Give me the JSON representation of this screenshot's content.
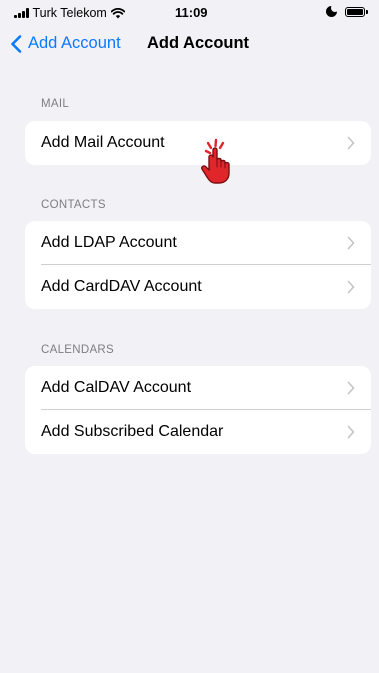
{
  "status_bar": {
    "carrier": "Turk Telekom",
    "time": "11:09",
    "icons": [
      "signal-icon",
      "wifi-icon",
      "moon-icon",
      "battery-icon"
    ]
  },
  "nav": {
    "back_label": "Add Account",
    "title": "Add Account"
  },
  "sections": {
    "mail": {
      "header": "MAIL",
      "rows": [
        "Add Mail Account"
      ]
    },
    "contacts": {
      "header": "CONTACTS",
      "rows": [
        "Add LDAP Account",
        "Add CardDAV Account"
      ]
    },
    "calendars": {
      "header": "CALENDARS",
      "rows": [
        "Add CalDAV Account",
        "Add Subscribed Calendar"
      ]
    }
  },
  "colors": {
    "accent": "#0a7aff",
    "background": "#f2f2f6",
    "cursor_annotation": "#e0262b"
  }
}
